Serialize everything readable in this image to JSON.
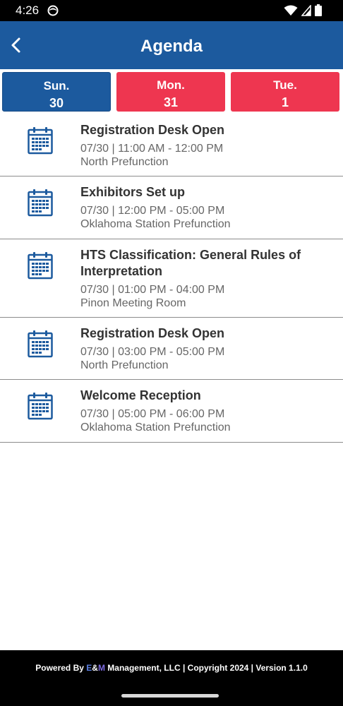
{
  "status_bar": {
    "time": "4:26",
    "icons": [
      "face-status-icon",
      "wifi-icon",
      "cellular-signal-icon",
      "battery-icon"
    ]
  },
  "header": {
    "title": "Agenda",
    "back_icon": "chevron-left-icon",
    "background_color": "#1c5a9e"
  },
  "day_tabs": [
    {
      "day": "Sun.",
      "date": "30",
      "active": true
    },
    {
      "day": "Mon.",
      "date": "31",
      "active": false
    },
    {
      "day": "Tue.",
      "date": "1",
      "active": false
    }
  ],
  "colors": {
    "active_tab": "#1c5a9e",
    "inactive_tab": "#ee3650",
    "icon": "#1c5a9e"
  },
  "agenda": [
    {
      "title": "Registration Desk Open",
      "time": "07/30 | 11:00 AM - 12:00 PM",
      "location": "North Prefunction",
      "icon": "calendar-icon"
    },
    {
      "title": "Exhibitors Set up",
      "time": "07/30 | 12:00 PM - 05:00 PM",
      "location": "Oklahoma Station Prefunction",
      "icon": "calendar-icon"
    },
    {
      "title": "HTS Classification: General Rules of Interpretation",
      "time": "07/30 | 01:00 PM - 04:00 PM",
      "location": "Pinon Meeting Room",
      "icon": "calendar-icon"
    },
    {
      "title": "Registration Desk Open",
      "time": "07/30 | 03:00 PM - 05:00 PM",
      "location": "North Prefunction",
      "icon": "calendar-icon"
    },
    {
      "title": "Welcome Reception",
      "time": "07/30 | 05:00 PM - 06:00 PM",
      "location": "Oklahoma Station Prefunction",
      "icon": "calendar-icon"
    }
  ],
  "footer": {
    "prefix": "Powered By ",
    "brand_e": "E",
    "brand_amp": "&",
    "brand_m": "M",
    "suffix": " Management, LLC | Copyright 2024 | Version 1.1.0"
  }
}
